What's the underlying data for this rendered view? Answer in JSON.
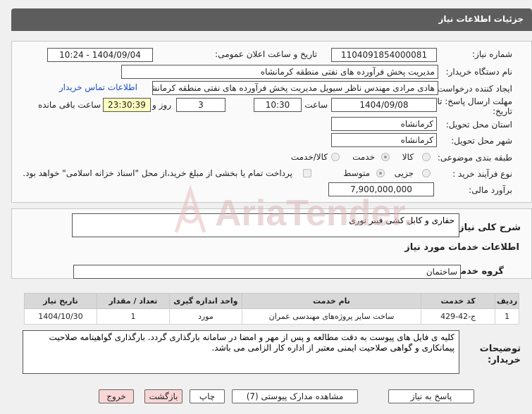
{
  "header": {
    "title": "جزئیات اطلاعات نیاز"
  },
  "form": {
    "need_number_label": "شماره نیاز:",
    "need_number": "1104091854000081",
    "announce_label": "تاریخ و ساعت اعلان عمومی:",
    "announce_value": "1404/09/04 - 10:24",
    "buyer_org_label": "نام دستگاه خریدار:",
    "buyer_org": "مدیریت پخش فرآورده های نفتی منطقه کرمانشاه",
    "creator_label": "ایجاد کننده درخواست:",
    "creator": "هادی مرادی مهندس ناظر سیویل مدیریت پخش فرآورده های نفتی منطقه کرمانشاه",
    "contact_link": "اطلاعات تماس خریدار",
    "deadline_label_1": "مهلت ارسال پاسخ: تا",
    "deadline_label_2": "تاریخ:",
    "deadline_date": "1404/09/08",
    "time_label": "ساعت",
    "deadline_time": "10:30",
    "days_value": "3",
    "days_label": "روز و",
    "remaining_time": "23:30:39",
    "remaining_label": "ساعت باقی مانده",
    "province_label": "استان محل تحویل:",
    "province": "کرمانشاه",
    "city_label": "شهر محل تحویل:",
    "city": "کرمانشاه",
    "category_label": "طبقه بندی موضوعی:",
    "category_options": [
      "کالا",
      "خدمت",
      "کالا/خدمت"
    ],
    "category_selected": "خدمت",
    "process_label": "نوع فرآیند خرید :",
    "process_options": [
      "جزیی",
      "متوسط"
    ],
    "process_selected": "متوسط",
    "payment_text": "پرداخت تمام یا بخشی از مبلغ خرید،از محل \"اسناد خزانه اسلامی\" خواهد بود.",
    "budget_label": "برآورد مالی:",
    "budget": "7,900,000,000"
  },
  "description": {
    "label": "شرح کلی نیاز:",
    "value": "حفاری و کابل کشی فیبر نوری"
  },
  "services": {
    "section_title": "اطلاعات خدمات مورد نیاز",
    "group_label": "گروه خدمت:",
    "group_value": "ساختمان",
    "columns": [
      "ردیف",
      "کد خدمت",
      "نام خدمت",
      "واحد اندازه گیری",
      "تعداد / مقدار",
      "تاریخ نیاز"
    ],
    "rows": [
      [
        "1",
        "ج-42-429",
        "ساخت سایر پروژه‌های مهندسی عمران",
        "مورد",
        "1",
        "1404/10/30"
      ]
    ]
  },
  "buyer_notes": {
    "label": "توضیحات خریدار:",
    "value": "کلیه ی فایل های پیوست به دقت مطالعه و پس از مهر و امضا در سامانه بارگذاری گردد. بارگذاری گواهینامه صلاحیت پیمانکاری و گواهی صلاحیت ایمنی معتبر از اداره کار الزامی می باشد."
  },
  "watermark": "AriaTender.neT",
  "buttons": {
    "reply": "پاسخ به نیاز",
    "attachments": "مشاهده مدارک پیوستی (7)",
    "print": "چاپ",
    "back": "بازگشت",
    "exit": "خروج"
  },
  "colors": {
    "header": "#5d5d5d",
    "link": "#1a4ebf",
    "remaining_bg": "#ffffc0",
    "back_exit_bg": "#f9d6d6"
  }
}
